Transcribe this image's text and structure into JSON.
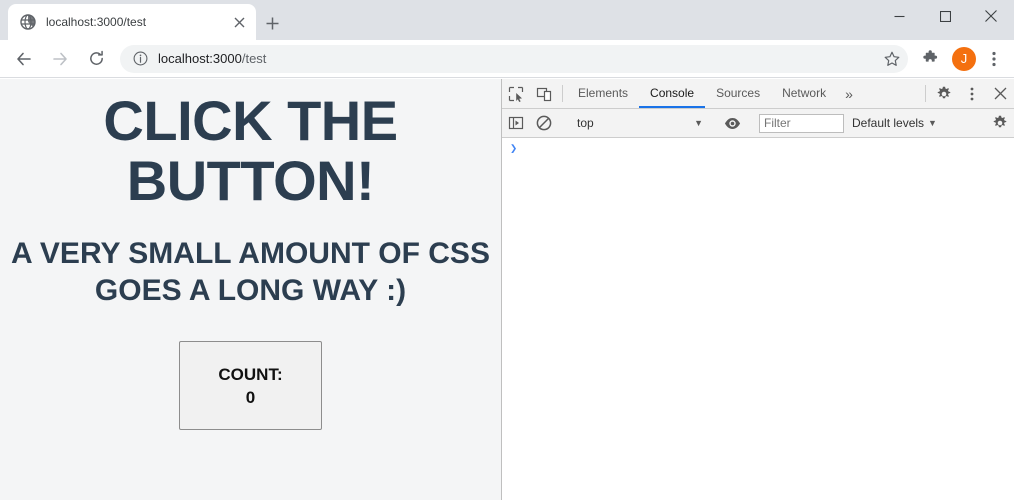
{
  "browser": {
    "tab": {
      "favicon": "globe-icon",
      "title": "localhost:3000/test",
      "close_label": "×"
    },
    "new_tab_label": "+",
    "window_controls": {
      "minimize": "minimize-icon",
      "maximize": "maximize-icon",
      "close": "close-icon"
    },
    "toolbar": {
      "back": "back-arrow-icon",
      "forward": "forward-arrow-icon",
      "reload": "reload-icon",
      "site_info": "info-icon",
      "url_host": "localhost:3000",
      "url_path": "/test",
      "url_full": "localhost:3000/test",
      "bookmark": "star-icon",
      "extensions": "puzzle-piece-icon",
      "profile_initial": "J",
      "menu": "three-dot-menu-icon"
    }
  },
  "page": {
    "heading": "CLICK THE BUTTON!",
    "subheading": "A VERY SMALL AMOUNT OF CSS GOES A LONG WAY :)",
    "button": {
      "label": "COUNT:",
      "count": "0"
    },
    "colors": {
      "background": "#f4f5f6",
      "text": "#2c3e50",
      "button_bg": "#f1f1f1",
      "button_border": "#8d8d8d"
    }
  },
  "devtools": {
    "inspect_icon": "inspect-element-icon",
    "device_icon": "device-toolbar-icon",
    "tabs": [
      {
        "label": "Elements",
        "active": false
      },
      {
        "label": "Console",
        "active": true
      },
      {
        "label": "Sources",
        "active": false
      },
      {
        "label": "Network",
        "active": false
      }
    ],
    "more_tabs": "»",
    "settings_icon": "gear-icon",
    "menu_icon": "three-dot-menu-icon",
    "close_icon": "close-icon",
    "filterbar": {
      "sidebar_icon": "console-sidebar-icon",
      "clear_icon": "clear-console-icon",
      "context": "top",
      "context_arrow": "▼",
      "eye_icon": "live-expression-eye-icon",
      "filter_placeholder": "Filter",
      "filter_value": "",
      "levels": "Default levels",
      "levels_arrow": "▼",
      "settings_icon": "gear-icon"
    },
    "console": {
      "prompt": "❯",
      "input_value": ""
    },
    "accent": "#1a73e8"
  }
}
